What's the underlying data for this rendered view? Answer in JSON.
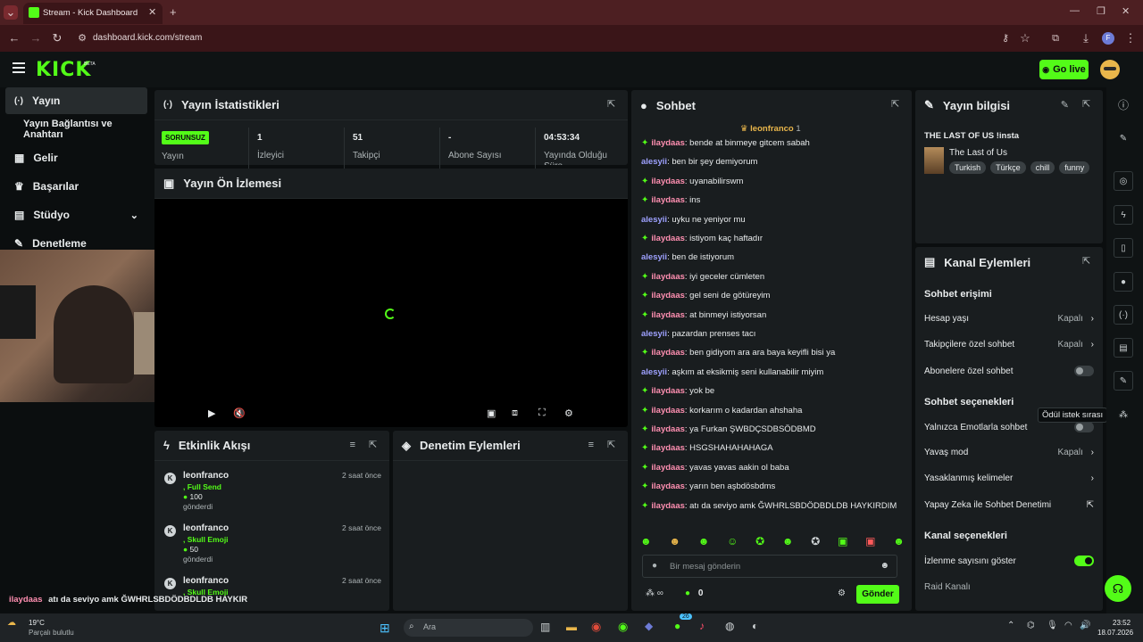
{
  "browser": {
    "tab_title": "Stream - Kick Dashboard",
    "url": "dashboard.kick.com/stream",
    "profile_initial": "F"
  },
  "header": {
    "logo": "KICK",
    "logo_badge": "BETA",
    "go_live": "Go live"
  },
  "sidebar": {
    "items": [
      {
        "label": "Yayın",
        "icon": "broadcast-icon"
      },
      {
        "label": "Yayın Bağlantısı ve Anahtarı",
        "icon": ""
      },
      {
        "label": "Gelir",
        "icon": "dashboard-icon"
      },
      {
        "label": "Başarılar",
        "icon": "trophy-icon"
      },
      {
        "label": "Stüdyo",
        "icon": "studio-icon"
      },
      {
        "label": "Denetleme",
        "icon": "wrench-icon"
      }
    ]
  },
  "stats": {
    "title": "Yayın İstatistikleri",
    "badge": "SORUNSUZ",
    "cells": [
      {
        "label": "Yayın",
        "value": ""
      },
      {
        "label": "İzleyici",
        "value": "1"
      },
      {
        "label": "Takipçi",
        "value": "51"
      },
      {
        "label": "Abone Sayısı",
        "value": "-"
      },
      {
        "label": "Yayında Olduğu Süre",
        "value": "04:53:34"
      }
    ]
  },
  "preview": {
    "title": "Yayın Ön İzlemesi"
  },
  "activity": {
    "title": "Etkinlik Akışı",
    "items": [
      {
        "user": "leonfranco",
        "action": ", Full Send",
        "amount": "100",
        "verb": "gönderdi",
        "time": "2 saat önce"
      },
      {
        "user": "leonfranco",
        "action": ", Skull Emoji",
        "amount": "50",
        "verb": "gönderdi",
        "time": "2 saat önce"
      },
      {
        "user": "leonfranco",
        "action": ", Skull Emoji",
        "amount": "",
        "verb": "",
        "time": "2 saat önce"
      }
    ]
  },
  "moderation": {
    "title": "Denetim Eylemleri"
  },
  "chat": {
    "title": "Sohbet",
    "pinned_user": "leonfranco",
    "pinned_count": "1",
    "messages": [
      {
        "user": "ilaydaas",
        "text": "bende at binmeye gitcem sabah",
        "type": 1
      },
      {
        "user": "alesyii",
        "text": "ben bir şey demiyorum",
        "type": 2
      },
      {
        "user": "ilaydaas",
        "text": "uyanabilirswm",
        "type": 1
      },
      {
        "user": "ilaydaas",
        "text": "ins",
        "type": 1
      },
      {
        "user": "alesyii",
        "text": "uyku ne yeniyor mu",
        "type": 2
      },
      {
        "user": "ilaydaas",
        "text": "istiyom kaç haftadır",
        "type": 1
      },
      {
        "user": "alesyii",
        "text": "ben de istiyorum",
        "type": 2
      },
      {
        "user": "ilaydaas",
        "text": "iyi geceler cümleten",
        "type": 1
      },
      {
        "user": "ilaydaas",
        "text": "gel seni de götüreyim",
        "type": 1
      },
      {
        "user": "ilaydaas",
        "text": "at binmeyi istiyorsan",
        "type": 1
      },
      {
        "user": "alesyii",
        "text": "pazardan prenses tacı",
        "type": 2
      },
      {
        "user": "ilaydaas",
        "text": "ben gidiyom ara ara baya keyifli bisi ya",
        "type": 1
      },
      {
        "user": "alesyii",
        "text": "aşkım at eksikmiş seni kullanabilir miyim",
        "type": 2
      },
      {
        "user": "ilaydaas",
        "text": "yok be",
        "type": 1
      },
      {
        "user": "ilaydaas",
        "text": "korkarım o kadardan ahshaha",
        "type": 1
      },
      {
        "user": "ilaydaas",
        "text": "ya Furkan ŞWBDÇSDBSÖDBMD",
        "type": 1
      },
      {
        "user": "ilaydaas",
        "text": "HSGSHAHAHAHAGA",
        "type": 1
      },
      {
        "user": "ilaydaas",
        "text": "yavas yavas aakin ol baba",
        "type": 1
      },
      {
        "user": "ilaydaas",
        "text": "yarın ben aşbdösbdms",
        "type": 1
      },
      {
        "user": "ilaydaas",
        "text": "atı da seviyo amk ĞWHRLSBDÖDBDLDB HAYKIRDIM",
        "type": 1
      }
    ],
    "input_placeholder": "Bir mesaj gönderin",
    "points": "0",
    "send": "Gönder"
  },
  "stream_info": {
    "title": "Yayın bilgisi",
    "stream_title": "THE LAST OF US !insta",
    "game": "The Last of Us",
    "tags": [
      "Turkish",
      "Türkçe",
      "chill",
      "funny"
    ]
  },
  "channel_actions": {
    "title": "Kanal Eylemleri",
    "chat_access": "Sohbet erişimi",
    "account_age": {
      "label": "Hesap yaşı",
      "value": "Kapalı"
    },
    "followers_only": {
      "label": "Takipçilere özel sohbet",
      "value": "Kapalı"
    },
    "subs_only": {
      "label": "Abonelere özel sohbet"
    },
    "chat_options": "Sohbet seçenekleri",
    "emote_only": {
      "label": "Yalnızca Emotlarla sohbet"
    },
    "slow_mode": {
      "label": "Yavaş mod",
      "value": "Kapalı"
    },
    "banned_words": {
      "label": "Yasaklanmış kelimeler"
    },
    "ai_mod": {
      "label": "Yapay Zeka ile Sohbet Denetimi"
    },
    "channel_options": "Kanal seçenekleri",
    "viewer_count": {
      "label": "İzlenme sayısını göster"
    },
    "raid": {
      "label": "Raid Kanalı"
    }
  },
  "tooltip": "Ödül istek sırası",
  "overlay_chat": {
    "user": "ilaydaas",
    "text": "atı da seviyo amk ĞWHRLSBDÖDBDLDB HAYKIR"
  },
  "taskbar": {
    "weather_temp": "19°C",
    "weather_desc": "Parçalı bulutlu",
    "search": "Ara",
    "time": "23:52",
    "date": "18.07.2026",
    "badge_count": "26"
  },
  "colors": {
    "accent": "#53fc18",
    "panel": "#191d1f",
    "bg": "#0b0e0f"
  }
}
